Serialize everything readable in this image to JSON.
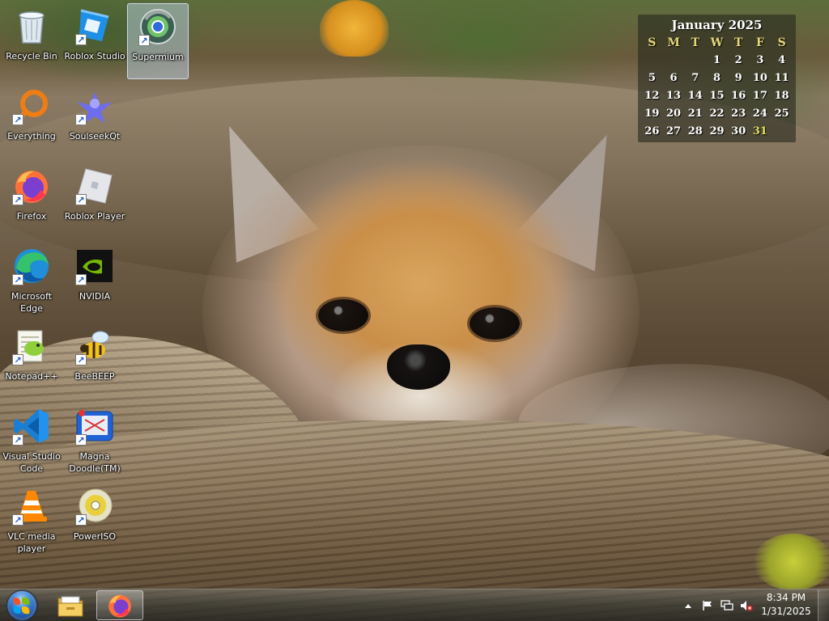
{
  "desktop": {
    "icons": [
      {
        "label": "Recycle Bin",
        "icon": "recycle-bin-icon"
      },
      {
        "label": "Roblox Studio",
        "icon": "roblox-studio-icon"
      },
      {
        "label": "Supermium",
        "icon": "supermium-icon"
      },
      {
        "label": "Everything",
        "icon": "everything-icon"
      },
      {
        "label": "SoulseekQt",
        "icon": "soulseekqt-icon"
      },
      {
        "label": "Firefox",
        "icon": "firefox-icon"
      },
      {
        "label": "Roblox Player",
        "icon": "roblox-player-icon"
      },
      {
        "label": "Microsoft Edge",
        "icon": "edge-icon"
      },
      {
        "label": "NVIDIA",
        "icon": "nvidia-icon"
      },
      {
        "label": "Notepad++",
        "icon": "notepadpp-icon"
      },
      {
        "label": "BeeBEEP",
        "icon": "beebeep-icon"
      },
      {
        "label": "Visual Studio Code",
        "icon": "vscode-icon"
      },
      {
        "label": "Magna Doodle(TM)",
        "icon": "magna-doodle-icon"
      },
      {
        "label": "VLC media player",
        "icon": "vlc-icon"
      },
      {
        "label": "PowerISO",
        "icon": "poweriso-icon"
      }
    ],
    "selected": "Supermium"
  },
  "calendar": {
    "title": "January 2025",
    "weekdays": [
      "S",
      "M",
      "T",
      "W",
      "T",
      "F",
      "S"
    ],
    "leading_blanks": 3,
    "days": [
      "1",
      "2",
      "3",
      "4",
      "5",
      "6",
      "7",
      "8",
      "9",
      "10",
      "11",
      "12",
      "13",
      "14",
      "15",
      "16",
      "17",
      "18",
      "19",
      "20",
      "21",
      "22",
      "23",
      "24",
      "25",
      "26",
      "27",
      "28",
      "29",
      "30",
      "31"
    ],
    "today": "31",
    "colors": {
      "weekday": "#e5d77a",
      "today": "#e5e05a",
      "day": "#ffffff"
    }
  },
  "taskbar": {
    "start_icon": "windows-logo-icon",
    "pinned": [
      {
        "name": "File Explorer",
        "icon": "file-explorer-icon"
      },
      {
        "name": "Firefox",
        "icon": "firefox-icon",
        "active": true
      }
    ],
    "tray_icons": [
      "chevron-up-icon",
      "flag-icon",
      "network-icon",
      "volume-muted-icon"
    ],
    "clock": {
      "time": "8:34 PM",
      "date": "1/31/2025"
    }
  }
}
